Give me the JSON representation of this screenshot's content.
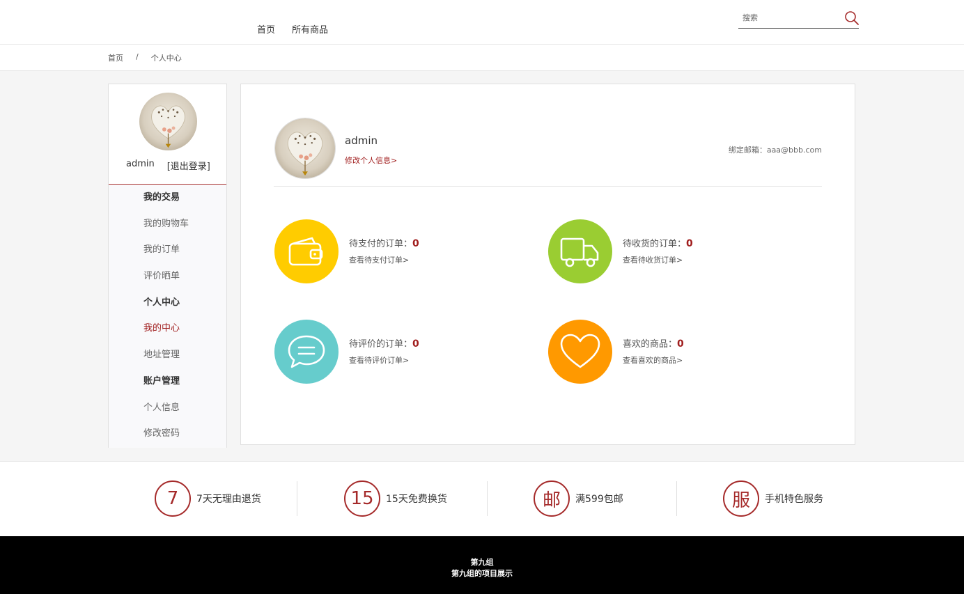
{
  "header": {
    "nav": [
      "首页",
      "所有商品"
    ],
    "search_placeholder": "搜索"
  },
  "breadcrumb": {
    "home": "首页",
    "separator": "/",
    "current": "个人中心"
  },
  "sidebar": {
    "username": "admin",
    "logout": "[退出登录]",
    "menu": [
      {
        "label": "我的交易",
        "type": "head"
      },
      {
        "label": "我的购物车",
        "type": "item"
      },
      {
        "label": "我的订单",
        "type": "item"
      },
      {
        "label": "评价晒单",
        "type": "item"
      },
      {
        "label": "个人中心",
        "type": "head"
      },
      {
        "label": "我的中心",
        "type": "active"
      },
      {
        "label": "地址管理",
        "type": "item"
      },
      {
        "label": "账户管理",
        "type": "head"
      },
      {
        "label": "个人信息",
        "type": "item"
      },
      {
        "label": "修改密码",
        "type": "item"
      }
    ]
  },
  "profile": {
    "username": "admin",
    "edit_link": "修改个人信息>",
    "email_label": "绑定邮箱：",
    "email": "aaa@bbb.com"
  },
  "stats": [
    {
      "label": "待支付的订单：",
      "count": "0",
      "link": "查看待支付订单>",
      "color": "#ffcc00",
      "icon": "wallet-icon"
    },
    {
      "label": "待收货的订单：",
      "count": "0",
      "link": "查看待收货订单>",
      "color": "#9acd32",
      "icon": "truck-icon"
    },
    {
      "label": "待评价的订单：",
      "count": "0",
      "link": "查看待评价订单>",
      "color": "#66cccc",
      "icon": "chat-bubble-icon"
    },
    {
      "label": "喜欢的商品：",
      "count": "0",
      "link": "查看喜欢的商品>",
      "color": "#ff9900",
      "icon": "heart-icon"
    }
  ],
  "services": [
    {
      "glyph": "7",
      "text": "7天无理由退货"
    },
    {
      "glyph": "15",
      "text": "15天免费换货"
    },
    {
      "glyph": "邮",
      "text": "满599包邮"
    },
    {
      "glyph": "服",
      "text": "手机特色服务"
    }
  ],
  "footer": {
    "line1": "第九组",
    "line2": "第九组的项目展示"
  },
  "colors": {
    "accent": "#a01d1d",
    "footer_bg": "#000000",
    "content_bg": "#f5f5f5"
  }
}
